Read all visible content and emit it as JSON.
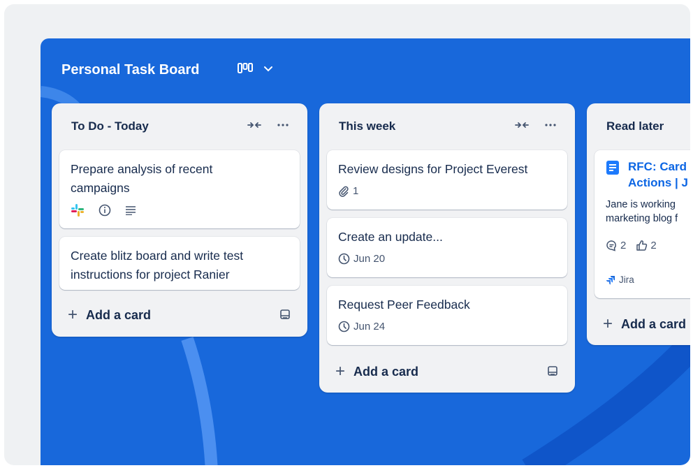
{
  "board": {
    "title": "Personal Task Board"
  },
  "lists": [
    {
      "title": "To Do - Today",
      "cards": [
        {
          "line1": "Prepare analysis of recent",
          "line2": "campaigns"
        },
        {
          "line1": "Create blitz board and write test",
          "line2": "instructions for project Ranier"
        }
      ],
      "add_label": "Add a card"
    },
    {
      "title": "This week",
      "cards": [
        {
          "text": "Review designs for Project Everest",
          "attachments": "1"
        },
        {
          "text": "Create an update...",
          "due": "Jun 20"
        },
        {
          "text": "Request Peer Feedback",
          "due": "Jun 24"
        }
      ],
      "add_label": "Add a card"
    },
    {
      "title": "Read later",
      "cards": [
        {
          "title_line1": "RFC: Card",
          "title_line2": "Actions | J",
          "desc_line1": "Jane is working",
          "desc_line2": "marketing blog f",
          "comments": "2",
          "likes": "2",
          "source": "Jira"
        }
      ],
      "add_label": "Add a card"
    }
  ],
  "colors": {
    "board_bg": "#1868db",
    "link": "#0c66e4",
    "list_bg": "#f1f2f4"
  }
}
